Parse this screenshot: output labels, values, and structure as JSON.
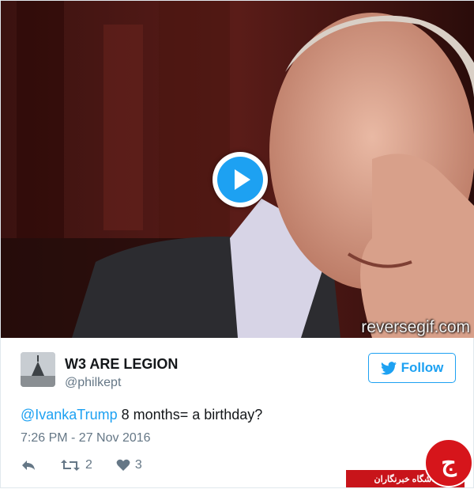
{
  "media": {
    "watermark": "reversegif.com",
    "play_icon": "play-icon"
  },
  "author": {
    "name": "W3 ARE LEGION",
    "handle": "@philkept"
  },
  "follow": {
    "label": "Follow",
    "icon": "twitter-bird-icon"
  },
  "tweet": {
    "mention": "@IvankaTrump",
    "text": " 8 months= a birthday?",
    "timestamp": "7:26 PM - 27 Nov 2016"
  },
  "actions": {
    "reply_icon": "reply-icon",
    "retweet_icon": "retweet-icon",
    "retweet_count": "2",
    "like_icon": "heart-icon",
    "like_count": "3"
  },
  "badge": {
    "text": "باشگاه خبرنگاران",
    "logo_text": "ج"
  },
  "colors": {
    "accent": "#1da1f2",
    "text": "#14171a",
    "muted": "#657786",
    "badge_red": "#c8141a"
  }
}
